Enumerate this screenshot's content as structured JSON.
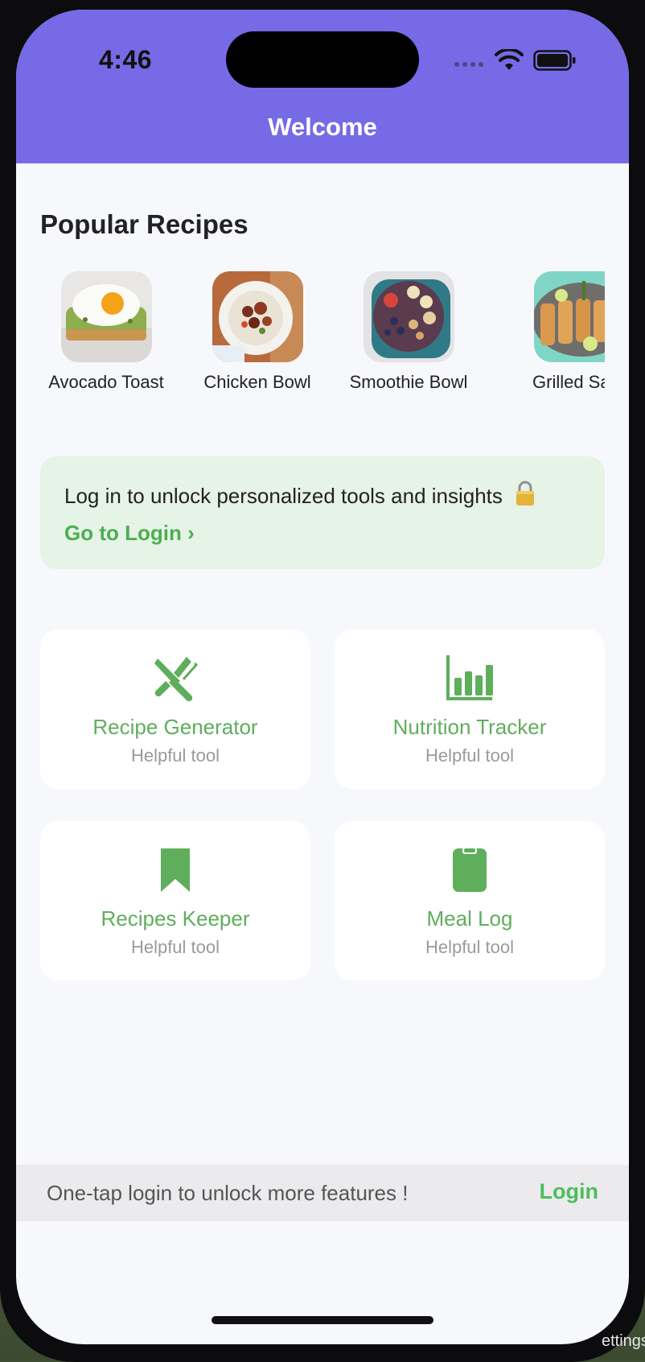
{
  "status_bar": {
    "time": "4:46"
  },
  "header": {
    "title": "Welcome"
  },
  "popular": {
    "title": "Popular Recipes",
    "items": [
      {
        "label": "Avocado Toast"
      },
      {
        "label": "Chicken Bowl"
      },
      {
        "label": "Smoothie Bowl"
      },
      {
        "label": "Grilled Salm"
      }
    ]
  },
  "banner": {
    "text": "Log in to unlock personalized tools and insights",
    "link": "Go to Login ›"
  },
  "tools": [
    {
      "label": "Recipe Generator",
      "sub": "Helpful tool",
      "icon": "fork-knife-icon"
    },
    {
      "label": "Nutrition Tracker",
      "sub": "Helpful tool",
      "icon": "bar-chart-icon"
    },
    {
      "label": "Recipes Keeper",
      "sub": "Helpful tool",
      "icon": "bookmark-icon"
    },
    {
      "label": "Meal Log",
      "sub": "Helpful tool",
      "icon": "clipboard-icon"
    }
  ],
  "bottom_bar": {
    "text": "One-tap login to unlock more features !",
    "login": "Login"
  },
  "background_corner_text": "ettings",
  "colors": {
    "header": "#776ae6",
    "accent_green": "#4caf50",
    "banner_bg": "#e6f3e7"
  }
}
